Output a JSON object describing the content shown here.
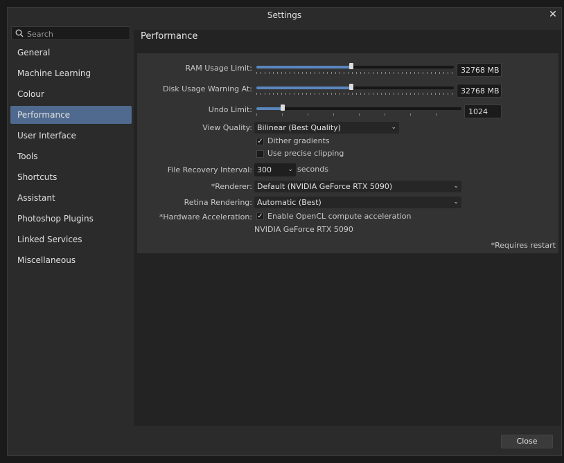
{
  "window": {
    "title": "Settings"
  },
  "search": {
    "placeholder": "Search"
  },
  "sidebar": {
    "items": [
      {
        "label": "General"
      },
      {
        "label": "Machine Learning"
      },
      {
        "label": "Colour"
      },
      {
        "label": "Performance"
      },
      {
        "label": "User Interface"
      },
      {
        "label": "Tools"
      },
      {
        "label": "Shortcuts"
      },
      {
        "label": "Assistant"
      },
      {
        "label": "Photoshop Plugins"
      },
      {
        "label": "Linked Services"
      },
      {
        "label": "Miscellaneous"
      }
    ],
    "active": "Performance"
  },
  "page": {
    "title": "Performance"
  },
  "settings": {
    "ram": {
      "label": "RAM Usage Limit:",
      "value": "32768 MB",
      "fraction": 0.48
    },
    "disk": {
      "label": "Disk Usage Warning At:",
      "value": "32768 MB",
      "fraction": 0.48
    },
    "undo": {
      "label": "Undo Limit:",
      "value": "1024",
      "fraction": 0.13
    },
    "view_quality": {
      "label": "View Quality:",
      "value": "Bilinear (Best Quality)"
    },
    "dither": {
      "label": "Dither gradients",
      "checked": true
    },
    "clipping": {
      "label": "Use precise clipping",
      "checked": false
    },
    "recovery": {
      "label": "File Recovery Interval:",
      "value": "300",
      "unit": "seconds"
    },
    "renderer": {
      "label": "*Renderer:",
      "value": "Default (NVIDIA GeForce RTX 5090)"
    },
    "retina": {
      "label": "Retina Rendering:",
      "value": "Automatic (Best)"
    },
    "hw": {
      "label": "*Hardware Acceleration:",
      "checkbox_label": "Enable OpenCL compute acceleration",
      "checked": true,
      "device": "NVIDIA GeForce RTX 5090"
    },
    "restart_note": "*Requires restart"
  },
  "footer": {
    "close_label": "Close"
  },
  "colors": {
    "accent": "#4f6a8e",
    "slider_fill": "#5a86bd"
  }
}
